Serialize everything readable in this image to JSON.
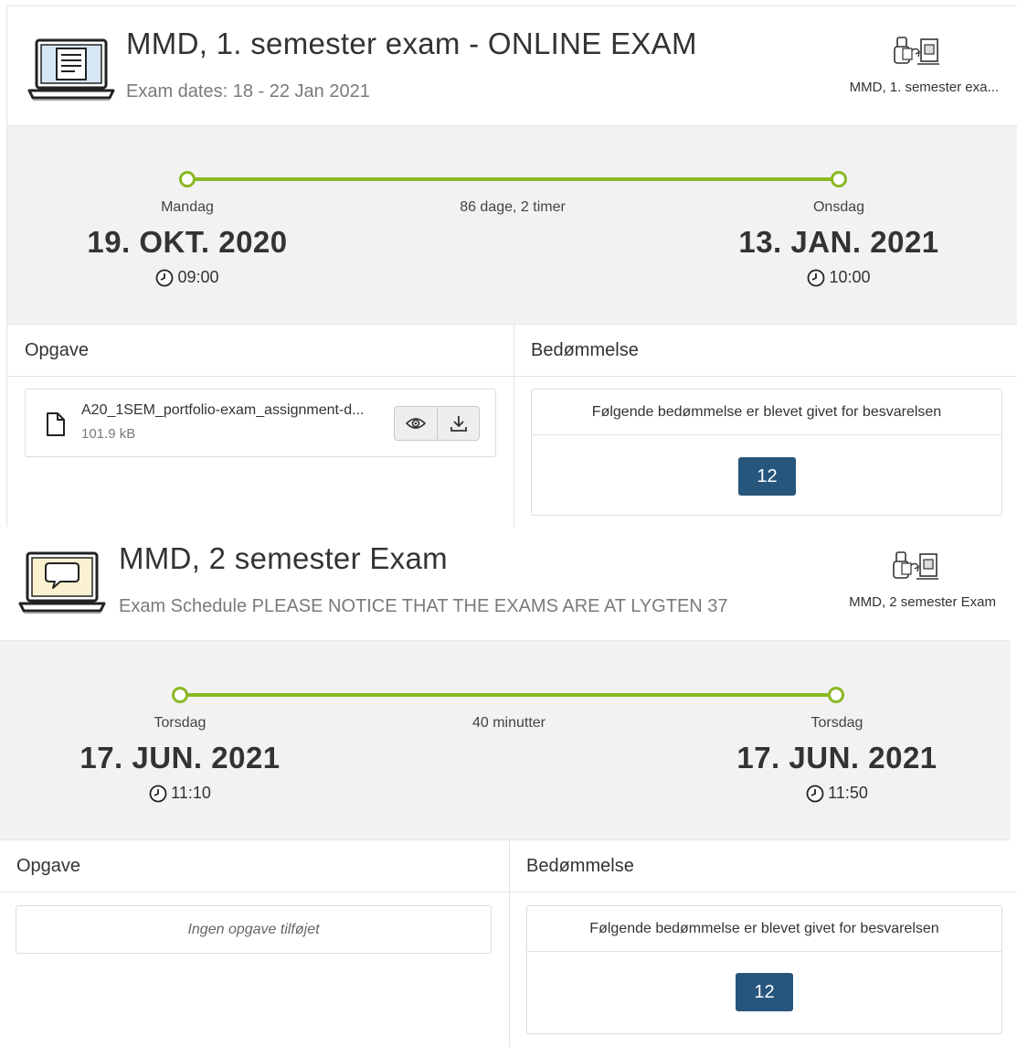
{
  "exams": [
    {
      "title": "MMD, 1. semester exam - ONLINE EXAM",
      "subtitle": "Exam dates: 18 - 22 Jan 2021",
      "course_name": "MMD, 1. semester exa...",
      "icon": "laptop-document-icon",
      "timeline": {
        "start": {
          "weekday": "Mandag",
          "date": "19. OKT. 2020",
          "time": "09:00"
        },
        "duration": "86 dage, 2 timer",
        "end": {
          "weekday": "Onsdag",
          "date": "13. JAN. 2021",
          "time": "10:00"
        }
      },
      "assignment_label": "Opgave",
      "assessment_label": "Bedømmelse",
      "file": {
        "name": "A20_1SEM_portfolio-exam_assignment-d...",
        "size": "101.9 kB"
      },
      "grade_text": "Følgende bedømmelse er blevet givet for besvarelsen",
      "grade": "12"
    },
    {
      "title": "MMD, 2 semester Exam",
      "subtitle": "Exam Schedule PLEASE NOTICE THAT THE EXAMS ARE AT LYGTEN 37",
      "course_name": "MMD, 2 semester Exam",
      "icon": "laptop-chat-icon",
      "timeline": {
        "start": {
          "weekday": "Torsdag",
          "date": "17. JUN. 2021",
          "time": "11:10"
        },
        "duration": "40 minutter",
        "end": {
          "weekday": "Torsdag",
          "date": "17. JUN. 2021",
          "time": "11:50"
        }
      },
      "assignment_label": "Opgave",
      "assessment_label": "Bedømmelse",
      "no_assignment": "Ingen opgave tilføjet",
      "grade_text": "Følgende bedømmelse er blevet givet for besvarelsen",
      "grade": "12"
    }
  ],
  "colors": {
    "timeline": "#8ab822",
    "grade_badge": "#27567d",
    "timeline_bg": "#f2f2f2"
  }
}
